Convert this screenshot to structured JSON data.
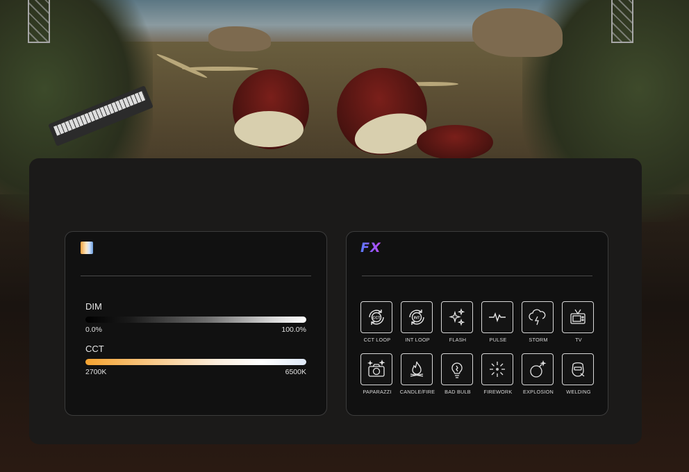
{
  "cct_panel": {
    "icon": "cct-gradient-icon",
    "dim": {
      "label": "DIM",
      "min": "0.0%",
      "max": "100.0%"
    },
    "cct": {
      "label": "CCT",
      "min": "2700K",
      "max": "6500K"
    }
  },
  "fx_panel": {
    "title": "FX",
    "effects": [
      {
        "label": "CCT LOOP",
        "icon": "cct-loop-icon"
      },
      {
        "label": "INT LOOP",
        "icon": "int-loop-icon"
      },
      {
        "label": "FLASH",
        "icon": "sparkle-icon"
      },
      {
        "label": "PULSE",
        "icon": "pulse-icon"
      },
      {
        "label": "STORM",
        "icon": "storm-icon"
      },
      {
        "label": "TV",
        "icon": "tv-icon"
      },
      {
        "label": "PAPARAZZI",
        "icon": "camera-icon"
      },
      {
        "label": "CANDLE/FIRE",
        "icon": "fire-icon"
      },
      {
        "label": "BAD BULB",
        "icon": "bulb-icon"
      },
      {
        "label": "FIREWORK",
        "icon": "firework-icon"
      },
      {
        "label": "EXPLOSION",
        "icon": "bomb-icon"
      },
      {
        "label": "WELDING",
        "icon": "welding-icon"
      }
    ]
  },
  "colors": {
    "panel_bg": "#1b1a19",
    "card_bg": "#111111",
    "fx_gradient_start": "#5a7cff",
    "fx_gradient_end": "#c04cf0",
    "cct_warm": "#f4a331",
    "cct_cool": "#dfe9f7"
  }
}
